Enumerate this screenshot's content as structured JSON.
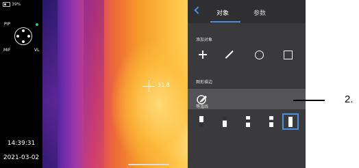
{
  "status": {
    "battery": "39%"
  },
  "leftbar": {
    "pip_label": "PIP",
    "mif_label": "MIF",
    "vl_label": "VL",
    "time": "14:39:31",
    "date": "2021-03-02"
  },
  "thermal": {
    "spot_temp": "31.8"
  },
  "panel": {
    "tabs": [
      {
        "label": "对象",
        "active": true
      },
      {
        "label": "参数",
        "active": false
      }
    ],
    "add_object_label": "添加对象",
    "tools": [
      "crosshair",
      "line",
      "circle",
      "rectangle"
    ],
    "shape_edit_label": "图形描边",
    "isotherm_label": "等温线",
    "isotherm_options": [
      "isotherm-1",
      "isotherm-2",
      "isotherm-3",
      "isotherm-4",
      "isotherm-5"
    ],
    "isotherm_selected_index": 4
  },
  "callout": {
    "label": "2."
  },
  "colors": {
    "accent": "#4a90e2",
    "panel_bg": "#3a3a3c",
    "highlight_row": "#545456"
  }
}
